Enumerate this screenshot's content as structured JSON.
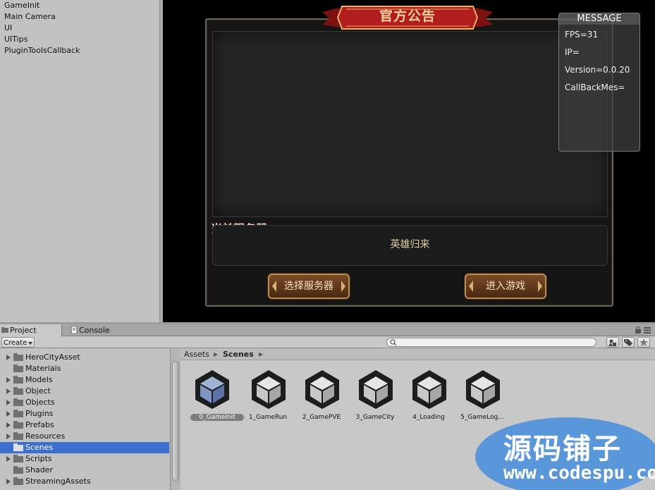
{
  "hierarchy": {
    "items": [
      "GameInit",
      "Main Camera",
      "UI",
      "UITips",
      "PluginToolsCallback"
    ]
  },
  "game": {
    "notice_title": "官方公告",
    "server_label": "当前服务器：",
    "server_name": "英雄归来",
    "select_server_button": "选择服务器",
    "enter_game_button": "进入游戏"
  },
  "message": {
    "title": "MESSAGE",
    "lines": [
      "FPS=31",
      "IP=",
      "Version=0.0.20",
      "CallBackMes="
    ]
  },
  "tabs": {
    "project": "Project",
    "console": "Console"
  },
  "toolbar": {
    "create_label": "Create"
  },
  "folders": [
    {
      "label": "HeroCityAsset",
      "expandable": true
    },
    {
      "label": "Materials",
      "expandable": false
    },
    {
      "label": "Models",
      "expandable": true
    },
    {
      "label": "Object",
      "expandable": true
    },
    {
      "label": "Objects",
      "expandable": true
    },
    {
      "label": "Plugins",
      "expandable": true
    },
    {
      "label": "Prefabs",
      "expandable": true
    },
    {
      "label": "Resources",
      "expandable": true
    },
    {
      "label": "Scenes",
      "expandable": false,
      "selected": true
    },
    {
      "label": "Scripts",
      "expandable": true
    },
    {
      "label": "Shader",
      "expandable": false
    },
    {
      "label": "StreamingAssets",
      "expandable": true
    }
  ],
  "breadcrumb": {
    "root": "Assets",
    "current": "Scenes"
  },
  "assets": [
    {
      "label": "0_GameInit",
      "selected": true
    },
    {
      "label": "1_GameRun"
    },
    {
      "label": "2_GamePVE"
    },
    {
      "label": "3_GameCity"
    },
    {
      "label": "4_Loading"
    },
    {
      "label": "5_GameLog..."
    }
  ],
  "watermark": {
    "line1": "源码铺子",
    "line2": "www.codespu.com"
  },
  "colors": {
    "selection": "#3d6fd0",
    "game_button": "#7a4a25",
    "ribbon": "#b21d1d",
    "watermark": "#4a90dc"
  }
}
